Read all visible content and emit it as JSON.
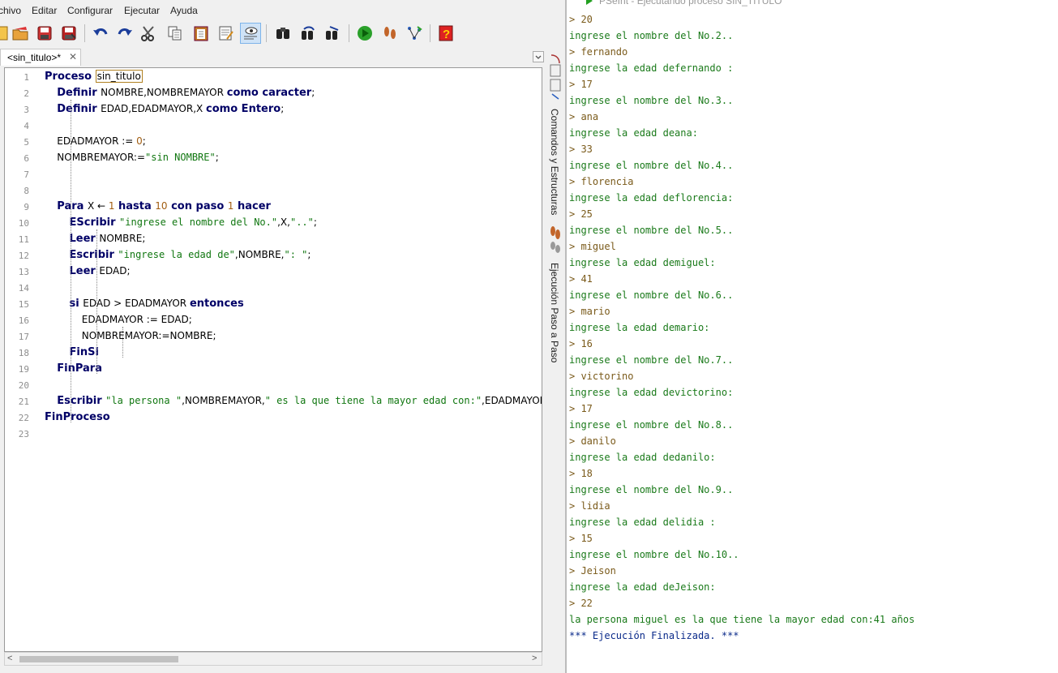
{
  "menu": [
    "chivo",
    "Editar",
    "Configurar",
    "Ejecutar",
    "Ayuda"
  ],
  "toolbar_icons": [
    "new-file-icon",
    "open-folder-icon",
    "save-icon",
    "save-as-icon",
    "undo-icon",
    "redo-icon",
    "cut-icon",
    "copy-icon",
    "paste-icon",
    "edit-icon",
    "indent-icon",
    "search-icon",
    "find-next-icon",
    "replace-icon",
    "run-icon",
    "step-icon",
    "flowchart-icon",
    "help-icon"
  ],
  "tab": {
    "label": "<sin_titulo>*",
    "close": "✕"
  },
  "side_panel": {
    "top_label": "Comandos y Estructuras",
    "bottom_label": "Ejecución Paso a Paso"
  },
  "code_lines": [
    [
      {
        "t": "kw",
        "v": "Proceso "
      },
      {
        "t": "ident",
        "v": "sin_titulo"
      }
    ],
    [
      {
        "t": "ind",
        "v": "    "
      },
      {
        "t": "kw",
        "v": "Definir "
      },
      {
        "t": "ident",
        "v": "NOMBRE,NOMBREMAYOR "
      },
      {
        "t": "kw",
        "v": "como caracter"
      },
      {
        "t": "op",
        "v": ";"
      }
    ],
    [
      {
        "t": "ind",
        "v": "    "
      },
      {
        "t": "kw",
        "v": "Definir "
      },
      {
        "t": "ident",
        "v": "EDAD,EDADMAYOR,X "
      },
      {
        "t": "kw",
        "v": "como Entero"
      },
      {
        "t": "op",
        "v": ";"
      }
    ],
    [],
    [
      {
        "t": "ind",
        "v": "    "
      },
      {
        "t": "ident",
        "v": "EDADMAYOR := "
      },
      {
        "t": "num",
        "v": "0"
      },
      {
        "t": "op",
        "v": ";"
      }
    ],
    [
      {
        "t": "ind",
        "v": "    "
      },
      {
        "t": "ident",
        "v": "NOMBREMAYOR:="
      },
      {
        "t": "str",
        "v": "\"sin NOMBRE\""
      },
      {
        "t": "op",
        "v": ";"
      }
    ],
    [],
    [],
    [
      {
        "t": "ind",
        "v": "    "
      },
      {
        "t": "kw",
        "v": "Para "
      },
      {
        "t": "ident",
        "v": "X ← "
      },
      {
        "t": "num",
        "v": "1"
      },
      {
        "t": "kw",
        "v": " hasta "
      },
      {
        "t": "num",
        "v": "10"
      },
      {
        "t": "kw",
        "v": " con paso "
      },
      {
        "t": "num",
        "v": "1"
      },
      {
        "t": "kw",
        "v": " hacer"
      }
    ],
    [
      {
        "t": "ind",
        "v": "        "
      },
      {
        "t": "kw",
        "v": "EScribir "
      },
      {
        "t": "str",
        "v": "\"ingrese el nombre del No.\""
      },
      {
        "t": "ident",
        "v": ",X,"
      },
      {
        "t": "str",
        "v": "\"..\""
      },
      {
        "t": "op",
        "v": ";"
      }
    ],
    [
      {
        "t": "ind",
        "v": "        "
      },
      {
        "t": "kw",
        "v": "Leer "
      },
      {
        "t": "ident",
        "v": "NOMBRE"
      },
      {
        "t": "op",
        "v": ";"
      }
    ],
    [
      {
        "t": "ind",
        "v": "        "
      },
      {
        "t": "kw",
        "v": "Escribir "
      },
      {
        "t": "str",
        "v": "\"ingrese la edad de\""
      },
      {
        "t": "ident",
        "v": ",NOMBRE,"
      },
      {
        "t": "str",
        "v": "\": \""
      },
      {
        "t": "op",
        "v": ";"
      }
    ],
    [
      {
        "t": "ind",
        "v": "        "
      },
      {
        "t": "kw",
        "v": "Leer "
      },
      {
        "t": "ident",
        "v": "EDAD"
      },
      {
        "t": "op",
        "v": ";"
      }
    ],
    [],
    [
      {
        "t": "ind",
        "v": "        "
      },
      {
        "t": "kw",
        "v": "si "
      },
      {
        "t": "ident",
        "v": "EDAD > EDADMAYOR "
      },
      {
        "t": "kw",
        "v": "entonces"
      }
    ],
    [
      {
        "t": "ind",
        "v": "            "
      },
      {
        "t": "ident",
        "v": "EDADMAYOR := EDAD"
      },
      {
        "t": "op",
        "v": ";"
      }
    ],
    [
      {
        "t": "ind",
        "v": "            "
      },
      {
        "t": "ident",
        "v": "NOMBREMAYOR:=NOMBRE"
      },
      {
        "t": "op",
        "v": ";"
      }
    ],
    [
      {
        "t": "ind",
        "v": "        "
      },
      {
        "t": "kw",
        "v": "FinSi"
      }
    ],
    [
      {
        "t": "ind",
        "v": "    "
      },
      {
        "t": "kw",
        "v": "FinPara"
      }
    ],
    [],
    [
      {
        "t": "ind",
        "v": "    "
      },
      {
        "t": "kw",
        "v": "Escribir "
      },
      {
        "t": "str",
        "v": "\"la persona \""
      },
      {
        "t": "ident",
        "v": ",NOMBREMAYOR,"
      },
      {
        "t": "str",
        "v": "\" es la que tiene la mayor edad con:\""
      },
      {
        "t": "ident",
        "v": ",EDADMAYOR"
      }
    ],
    [
      {
        "t": "kw",
        "v": "FinProceso"
      }
    ],
    []
  ],
  "terminal": {
    "title": "PSeInt - Ejecutando proceso SIN_TITULO",
    "lines": [
      {
        "t": "in",
        "v": "> 20"
      },
      {
        "t": "out",
        "v": "ingrese el nombre del No.2.."
      },
      {
        "t": "in",
        "v": "> fernando"
      },
      {
        "t": "out",
        "v": "ingrese la edad defernando :"
      },
      {
        "t": "in",
        "v": "> 17"
      },
      {
        "t": "out",
        "v": "ingrese el nombre del No.3.."
      },
      {
        "t": "in",
        "v": "> ana"
      },
      {
        "t": "out",
        "v": "ingrese la edad deana:"
      },
      {
        "t": "in",
        "v": "> 33"
      },
      {
        "t": "out",
        "v": "ingrese el nombre del No.4.."
      },
      {
        "t": "in",
        "v": "> florencia"
      },
      {
        "t": "out",
        "v": "ingrese la edad deflorencia:"
      },
      {
        "t": "in",
        "v": "> 25"
      },
      {
        "t": "out",
        "v": "ingrese el nombre del No.5.."
      },
      {
        "t": "in",
        "v": "> miguel"
      },
      {
        "t": "out",
        "v": "ingrese la edad demiguel:"
      },
      {
        "t": "in",
        "v": "> 41"
      },
      {
        "t": "out",
        "v": "ingrese el nombre del No.6.."
      },
      {
        "t": "in",
        "v": "> mario"
      },
      {
        "t": "out",
        "v": "ingrese la edad demario:"
      },
      {
        "t": "in",
        "v": "> 16"
      },
      {
        "t": "out",
        "v": "ingrese el nombre del No.7.."
      },
      {
        "t": "in",
        "v": "> victorino"
      },
      {
        "t": "out",
        "v": "ingrese la edad devictorino:"
      },
      {
        "t": "in",
        "v": "> 17"
      },
      {
        "t": "out",
        "v": "ingrese el nombre del No.8.."
      },
      {
        "t": "in",
        "v": "> danilo"
      },
      {
        "t": "out",
        "v": "ingrese la edad dedanilo:"
      },
      {
        "t": "in",
        "v": "> 18"
      },
      {
        "t": "out",
        "v": "ingrese el nombre del No.9.."
      },
      {
        "t": "in",
        "v": "> lidia"
      },
      {
        "t": "out",
        "v": "ingrese la edad delidia :"
      },
      {
        "t": "in",
        "v": "> 15"
      },
      {
        "t": "out",
        "v": "ingrese el nombre del No.10.."
      },
      {
        "t": "in",
        "v": "> Jeison"
      },
      {
        "t": "out",
        "v": "ingrese la edad deJeison:"
      },
      {
        "t": "in",
        "v": "> 22"
      },
      {
        "t": "out",
        "v": "la persona miguel es la que tiene la mayor edad con:41 años"
      },
      {
        "t": "sys",
        "v": "*** Ejecución Finalizada. ***"
      }
    ]
  }
}
